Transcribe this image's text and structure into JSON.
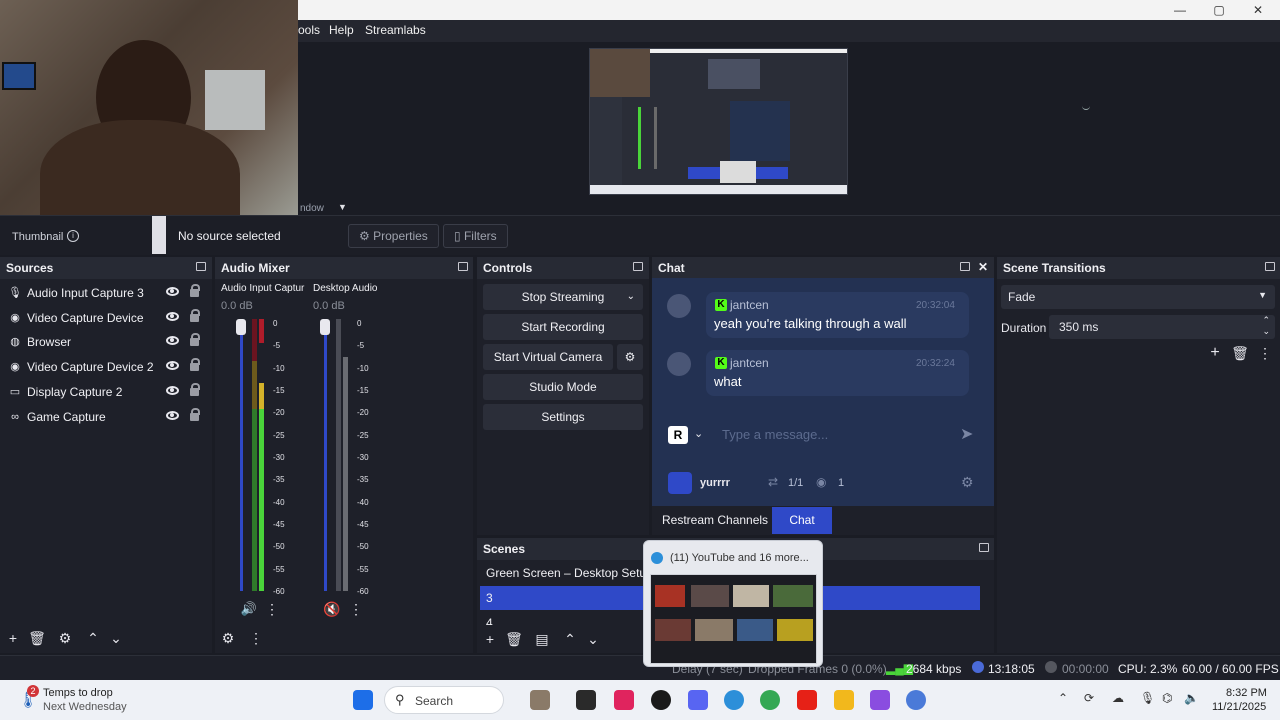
{
  "titlebar": {
    "minimize": "—",
    "maximize": "▢",
    "close": "✕"
  },
  "menu": {
    "tools": "ools",
    "help": "Help",
    "streamlabs": "Streamlabs"
  },
  "source_bar": {
    "partial_label": "ndow",
    "thumbnail_label": "Thumbnail",
    "status": "No source selected",
    "properties_label": "Properties",
    "filters_label": "Filters"
  },
  "sources": {
    "title": "Sources",
    "items": [
      {
        "label": "Audio Input Capture 3",
        "icon": "microphone-icon"
      },
      {
        "label": "Video Capture Device",
        "icon": "camera-icon"
      },
      {
        "label": "Browser",
        "icon": "globe-icon"
      },
      {
        "label": "Video Capture Device 2",
        "icon": "camera-icon"
      },
      {
        "label": "Display Capture 2",
        "icon": "monitor-icon"
      },
      {
        "label": "Game Capture",
        "icon": "gamepad-icon"
      }
    ]
  },
  "mixer": {
    "title": "Audio Mixer",
    "channels": [
      {
        "name": "Audio Input Captur",
        "db": "0.0 dB"
      },
      {
        "name": "Desktop Audio",
        "db": "0.0 dB"
      }
    ],
    "scale": [
      "0",
      "-5",
      "-10",
      "-15",
      "-20",
      "-25",
      "-30",
      "-35",
      "-40",
      "-45",
      "-50",
      "-55",
      "-60"
    ]
  },
  "controls": {
    "title": "Controls",
    "stop_streaming": "Stop Streaming",
    "start_recording": "Start Recording",
    "start_virtual_camera": "Start Virtual Camera",
    "studio_mode": "Studio Mode",
    "settings": "Settings"
  },
  "chat": {
    "title": "Chat",
    "messages": [
      {
        "user": "jantcen",
        "time": "20:32:04",
        "text": "yeah you're talking through a wall"
      },
      {
        "user": "jantcen",
        "time": "20:32:24",
        "text": "what"
      }
    ],
    "placeholder": "Type a message...",
    "sender_initial": "R",
    "account": "yurrrr",
    "viewer_ratio": "1/1",
    "viewers": "1",
    "tab_restream": "Restream Channels",
    "tab_chat": "Chat"
  },
  "transitions": {
    "title": "Scene Transitions",
    "selected": "Fade",
    "duration_label": "Duration",
    "duration_value": "350 ms"
  },
  "scenes": {
    "title": "Scenes",
    "items": [
      "Green Screen – Desktop Setup",
      "3",
      "4"
    ]
  },
  "thumbnail_popup": {
    "title": "(11) YouTube and 16 more..."
  },
  "status": {
    "delay": "Delay (7 sec)",
    "dropped": "Dropped Frames 0 (0.0%)",
    "bitrate": "2684 kbps",
    "stream_time": "13:18:05",
    "rec_time": "00:00:00",
    "cpu": "CPU: 2.3%",
    "fps": "60.00 / 60.00 FPS"
  },
  "taskbar": {
    "weather_badge": "2",
    "weather_line1": "Temps to drop",
    "weather_line2": "Next Wednesday",
    "search": "Search",
    "time": "8:32 PM",
    "date": "11/21/2025"
  },
  "colors": {
    "accent_blue": "#2f49c8",
    "meter_green": "#4ad43a",
    "meter_yellow": "#d4b22a",
    "meter_red": "#b01c2a",
    "kick_green": "#53fc18"
  }
}
